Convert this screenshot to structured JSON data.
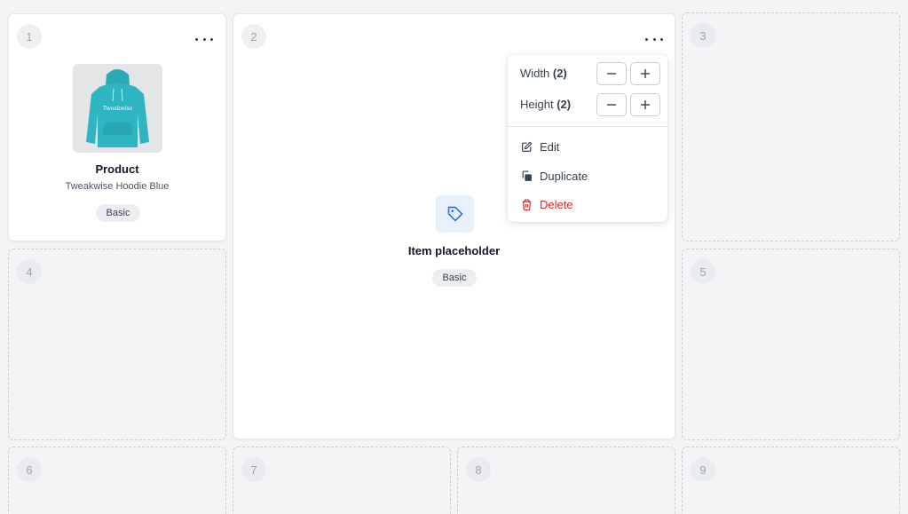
{
  "grid": {
    "slot1": {
      "number": "1",
      "card_type": "Product",
      "product_name": "Tweakwise Hoodie Blue",
      "badge": "Basic",
      "image_icon": "hoodie-image",
      "hoodie_color": "#2fb5c2",
      "hoodie_print": "Tweakwise"
    },
    "slot2": {
      "number": "2",
      "card_type": "Item placeholder",
      "badge": "Basic",
      "icon": "tag-icon"
    },
    "slot3": {
      "number": "3"
    },
    "slot4": {
      "number": "4"
    },
    "slot5": {
      "number": "5"
    },
    "slot6": {
      "number": "6"
    },
    "slot7": {
      "number": "7"
    },
    "slot8": {
      "number": "8"
    },
    "slot9": {
      "number": "9"
    }
  },
  "context_menu": {
    "width_label": "Width",
    "width_value": "(2)",
    "height_label": "Height",
    "height_value": "(2)",
    "items": [
      {
        "label": "Edit",
        "icon": "edit-icon"
      },
      {
        "label": "Duplicate",
        "icon": "duplicate-icon"
      },
      {
        "label": "Delete",
        "icon": "trash-icon"
      }
    ]
  },
  "colors": {
    "accent": "#2563eb",
    "danger": "#dc2626",
    "background": "#f3f4f6"
  }
}
